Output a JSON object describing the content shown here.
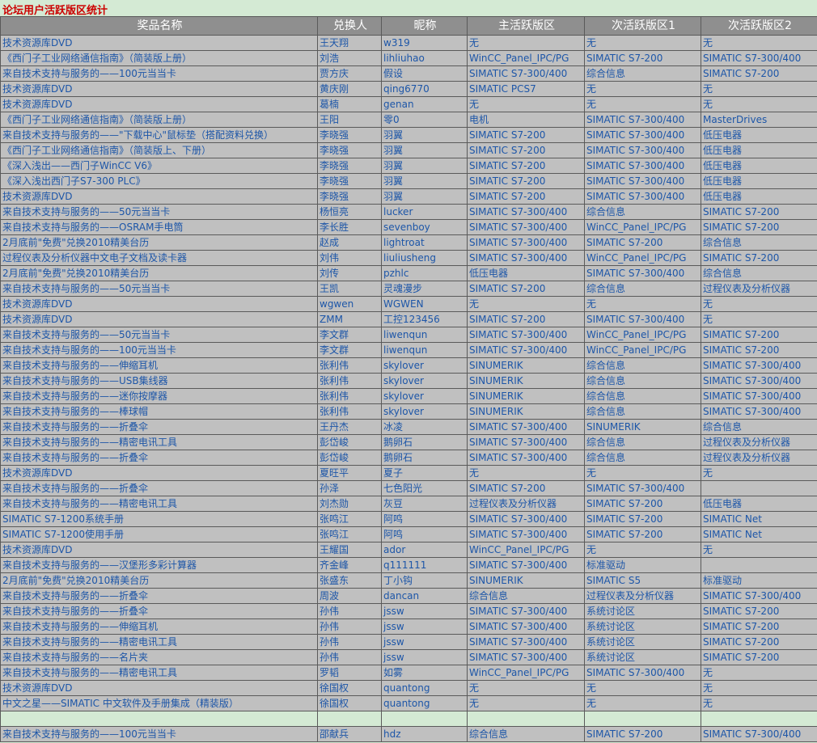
{
  "title": "论坛用户活跃版区统计",
  "columns": [
    "奖品名称",
    "兑换人",
    "昵称",
    "主活跃版区",
    "次活跃版区1",
    "次活跃版区2"
  ],
  "rows": [
    [
      "技术资源库DVD",
      "王天翔",
      "w319",
      "无",
      "无",
      "无"
    ],
    [
      "《西门子工业网络通信指南》（简装版上册）",
      "刘浩",
      "lihliuhao",
      "WinCC_Panel_IPC/PG",
      "SIMATIC S7-200",
      "SIMATIC S7-300/400"
    ],
    [
      "来自技术支持与服务的——100元当当卡",
      "贾方庆",
      "假设",
      "SIMATIC S7-300/400",
      "综合信息",
      "SIMATIC S7-200"
    ],
    [
      "技术资源库DVD",
      "黄庆刚",
      "qing6770",
      "SIMATIC PCS7",
      "无",
      "无"
    ],
    [
      "技术资源库DVD",
      "葛楠",
      "genan",
      "无",
      "无",
      "无"
    ],
    [
      "《西门子工业网络通信指南》（简装版上册）",
      "王阳",
      "零0",
      "电机",
      "SIMATIC S7-300/400",
      "MasterDrives"
    ],
    [
      "来自技术支持与服务的——\"下载中心\"鼠标垫（搭配资料兑换）",
      "李晓强",
      "羽翼",
      "SIMATIC S7-200",
      "SIMATIC S7-300/400",
      "低压电器"
    ],
    [
      "《西门子工业网络通信指南》（简装版上、下册）",
      "李晓强",
      "羽翼",
      "SIMATIC S7-200",
      "SIMATIC S7-300/400",
      "低压电器"
    ],
    [
      "《深入浅出——西门子WinCC V6》",
      "李晓强",
      "羽翼",
      "SIMATIC S7-200",
      "SIMATIC S7-300/400",
      "低压电器"
    ],
    [
      "《深入浅出西门子S7-300 PLC》",
      "李晓强",
      "羽翼",
      "SIMATIC S7-200",
      "SIMATIC S7-300/400",
      "低压电器"
    ],
    [
      "技术资源库DVD",
      "李晓强",
      "羽翼",
      "SIMATIC S7-200",
      "SIMATIC S7-300/400",
      "低压电器"
    ],
    [
      "来自技术支持与服务的——50元当当卡",
      "杨恒亮",
      "lucker",
      "SIMATIC S7-300/400",
      "综合信息",
      "SIMATIC S7-200"
    ],
    [
      "来自技术支持与服务的——OSRAM手电筒",
      "李长胜",
      "sevenboy",
      "SIMATIC S7-300/400",
      "WinCC_Panel_IPC/PG",
      "SIMATIC S7-200"
    ],
    [
      "2月底前\"免费\"兑换2010精美台历",
      "赵成",
      "lightroat",
      "SIMATIC S7-300/400",
      "SIMATIC S7-200",
      "综合信息"
    ],
    [
      "过程仪表及分析仪器中文电子文档及读卡器",
      "刘伟",
      "liuliusheng",
      "SIMATIC S7-300/400",
      "WinCC_Panel_IPC/PG",
      "SIMATIC S7-200"
    ],
    [
      "2月底前\"免费\"兑换2010精美台历",
      "刘传",
      "pzhlc",
      "低压电器",
      "SIMATIC S7-300/400",
      "综合信息"
    ],
    [
      "来自技术支持与服务的——50元当当卡",
      "王凯",
      "灵魂漫步",
      "SIMATIC S7-200",
      "综合信息",
      "过程仪表及分析仪器"
    ],
    [
      "技术资源库DVD",
      "wgwen",
      "WGWEN",
      "无",
      "无",
      "无"
    ],
    [
      "技术资源库DVD",
      "ZMM",
      "工控123456",
      "SIMATIC S7-200",
      "SIMATIC S7-300/400",
      "无"
    ],
    [
      "来自技术支持与服务的——50元当当卡",
      "李文群",
      "liwenqun",
      "SIMATIC S7-300/400",
      "WinCC_Panel_IPC/PG",
      "SIMATIC S7-200"
    ],
    [
      "来自技术支持与服务的——100元当当卡",
      "李文群",
      "liwenqun",
      "SIMATIC S7-300/400",
      "WinCC_Panel_IPC/PG",
      "SIMATIC S7-200"
    ],
    [
      "来自技术支持与服务的——伸缩耳机",
      "张利伟",
      "skylover",
      "SINUMERIK",
      "综合信息",
      "SIMATIC S7-300/400"
    ],
    [
      "来自技术支持与服务的——USB集线器",
      "张利伟",
      "skylover",
      "SINUMERIK",
      "综合信息",
      "SIMATIC S7-300/400"
    ],
    [
      "来自技术支持与服务的——迷你按摩器",
      "张利伟",
      "skylover",
      "SINUMERIK",
      "综合信息",
      "SIMATIC S7-300/400"
    ],
    [
      "来自技术支持与服务的——棒球帽",
      "张利伟",
      "skylover",
      "SINUMERIK",
      "综合信息",
      "SIMATIC S7-300/400"
    ],
    [
      "来自技术支持与服务的——折叠伞",
      "王丹杰",
      "冰凌",
      "SIMATIC S7-300/400",
      "SINUMERIK",
      "综合信息"
    ],
    [
      "来自技术支持与服务的——精密电讯工具",
      "彭岱峻",
      "鹅卵石",
      "SIMATIC S7-300/400",
      "综合信息",
      "过程仪表及分析仪器"
    ],
    [
      "来自技术支持与服务的——折叠伞",
      "彭岱峻",
      "鹅卵石",
      "SIMATIC S7-300/400",
      "综合信息",
      "过程仪表及分析仪器"
    ],
    [
      "技术资源库DVD",
      "夏旺平",
      "夏子",
      "无",
      "无",
      "无"
    ],
    [
      "来自技术支持与服务的——折叠伞",
      "孙泽",
      "七色阳光",
      "SIMATIC S7-200",
      "SIMATIC S7-300/400",
      ""
    ],
    [
      "来自技术支持与服务的——精密电讯工具",
      "刘杰勋",
      "灰豆",
      "过程仪表及分析仪器",
      "SIMATIC S7-200",
      "低压电器"
    ],
    [
      "SIMATIC S7-1200系统手册",
      "张鸣江",
      "阿鸣",
      "SIMATIC S7-300/400",
      "SIMATIC S7-200",
      "SIMATIC Net"
    ],
    [
      "SIMATIC S7-1200使用手册",
      "张鸣江",
      "阿鸣",
      "SIMATIC S7-300/400",
      "SIMATIC S7-200",
      "SIMATIC Net"
    ],
    [
      "技术资源库DVD",
      "王耀国",
      "ador",
      "WinCC_Panel_IPC/PG",
      "无",
      "无"
    ],
    [
      "来自技术支持与服务的——汉堡形多彩计算器",
      "齐金峰",
      "q111111",
      "SIMATIC S7-300/400",
      "标准驱动",
      ""
    ],
    [
      "2月底前\"免费\"兑换2010精美台历",
      "张盛东",
      "丁小钩",
      "SINUMERIK",
      "SIMATIC S5",
      "标准驱动"
    ],
    [
      "来自技术支持与服务的——折叠伞",
      "周波",
      "dancan",
      "综合信息",
      "过程仪表及分析仪器",
      "SIMATIC S7-300/400"
    ],
    [
      "来自技术支持与服务的——折叠伞",
      "孙伟",
      "jssw",
      "SIMATIC S7-300/400",
      "系统讨论区",
      "SIMATIC S7-200"
    ],
    [
      "来自技术支持与服务的——伸缩耳机",
      "孙伟",
      "jssw",
      "SIMATIC S7-300/400",
      "系统讨论区",
      "SIMATIC S7-200"
    ],
    [
      "来自技术支持与服务的——精密电讯工具",
      "孙伟",
      "jssw",
      "SIMATIC S7-300/400",
      "系统讨论区",
      "SIMATIC S7-200"
    ],
    [
      "来自技术支持与服务的——名片夹",
      "孙伟",
      "jssw",
      "SIMATIC S7-300/400",
      "系统讨论区",
      "SIMATIC S7-200"
    ],
    [
      "来自技术支持与服务的——精密电讯工具",
      "罗韬",
      "如雾",
      "WinCC_Panel_IPC/PG",
      "SIMATIC S7-300/400",
      "无"
    ],
    [
      "技术资源库DVD",
      "徐国权",
      "quantong",
      "无",
      "无",
      "无"
    ],
    [
      "中文之星——SIMATIC 中文软件及手册集成（精装版）",
      "徐国权",
      "quantong",
      "无",
      "无",
      "无"
    ],
    [
      "",
      "",
      "",
      "",
      "",
      ""
    ],
    [
      "来自技术支持与服务的——100元当当卡",
      "邵献兵",
      "hdz",
      "综合信息",
      "SIMATIC S7-200",
      "SIMATIC S7-300/400"
    ]
  ]
}
